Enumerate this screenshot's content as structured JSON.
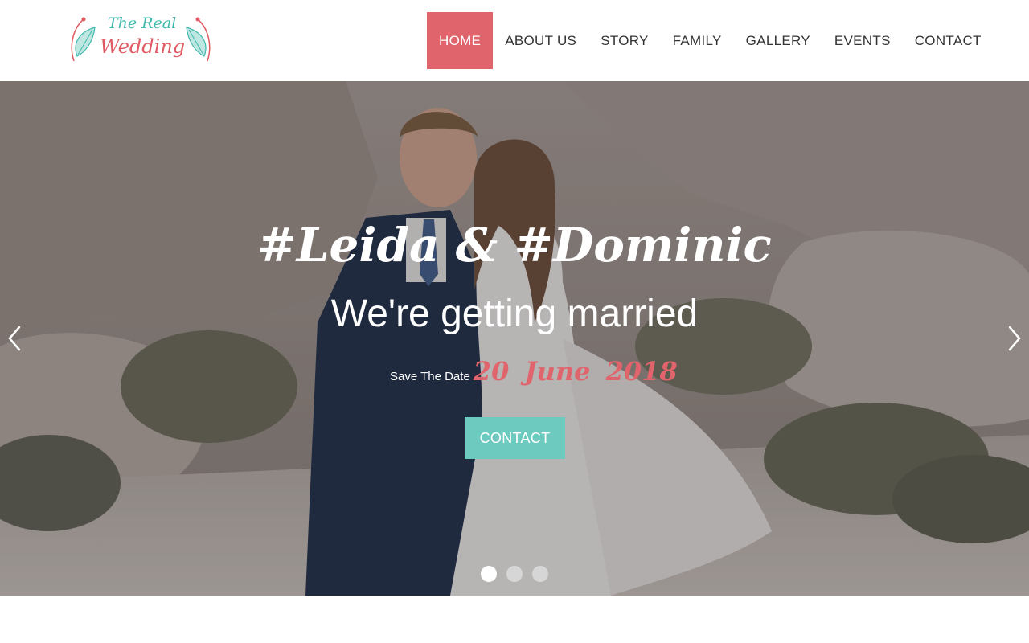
{
  "logo": {
    "line1": "The Real",
    "line2": "Wedding",
    "colors": {
      "teal": "#3fb8ad",
      "coral": "#df5a63"
    }
  },
  "nav": {
    "items": [
      {
        "label": "HOME",
        "active": true
      },
      {
        "label": "ABOUT US",
        "active": false
      },
      {
        "label": "STORY",
        "active": false
      },
      {
        "label": "FAMILY",
        "active": false
      },
      {
        "label": "GALLERY",
        "active": false
      },
      {
        "label": "EVENTS",
        "active": false
      },
      {
        "label": "CONTACT",
        "active": false
      }
    ],
    "active_color": "#e0646b"
  },
  "hero": {
    "names": "#Leida  &  #Dominic",
    "tagline": "We're getting married",
    "save_label": "Save The Date",
    "save_date": "20  June  2018",
    "contact_button": "CONTACT",
    "prev_icon": "chevron-left-icon",
    "next_icon": "chevron-right-icon",
    "slides": {
      "count": 3,
      "active_index": 0
    },
    "colors": {
      "date": "#e0646b",
      "button": "#6ccabf"
    }
  }
}
